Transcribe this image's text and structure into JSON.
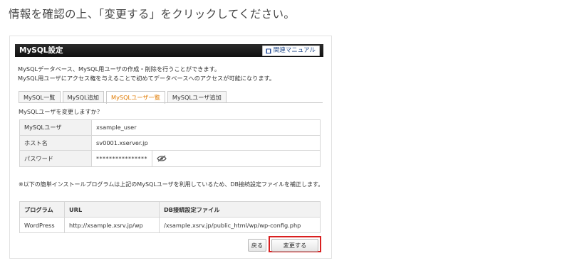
{
  "instruction": "情報を確認の上、「変更する」をクリックしてください。",
  "panel": {
    "title": "MySQL設定",
    "manual_label": "関連マニュアル",
    "desc_line1": "MySQLデータベース、MySQL用ユーザの作成・削除を行うことができます。",
    "desc_line2": "MySQL用ユーザにアクセス権を与えることで初めてデータベースへのアクセスが可能になります。"
  },
  "tabs": [
    {
      "label": "MySQL一覧"
    },
    {
      "label": "MySQL追加"
    },
    {
      "label": "MySQLユーザ一覧",
      "active": true
    },
    {
      "label": "MySQLユーザ追加"
    }
  ],
  "question": "MySQLユーザを変更しますか？",
  "user_table": {
    "user_label": "MySQLユーザ",
    "user_value": "xsample_user",
    "host_label": "ホスト名",
    "host_value": "sv0001.xserver.jp",
    "password_label": "パスワード",
    "password_value": "****************"
  },
  "note": "※以下の簡単インストールプログラムは上記のMySQLユーザを利用しているため、DB接続設定ファイルを補正します。",
  "program_table": {
    "headers": [
      "プログラム",
      "URL",
      "DB接続設定ファイル"
    ],
    "rows": [
      [
        "WordPress",
        "http://xsample.xsrv.jp/wp",
        "/xsample.xsrv.jp/public_html/wp/wp-config.php"
      ]
    ]
  },
  "buttons": {
    "back": "戻る",
    "change": "変更する"
  },
  "colors": {
    "titlebar": "#1a1a1a",
    "active_tab": "#e07a00",
    "highlight": "#d92020"
  },
  "icons": {
    "manual": "book-icon",
    "password_toggle": "eye-slash-icon"
  }
}
